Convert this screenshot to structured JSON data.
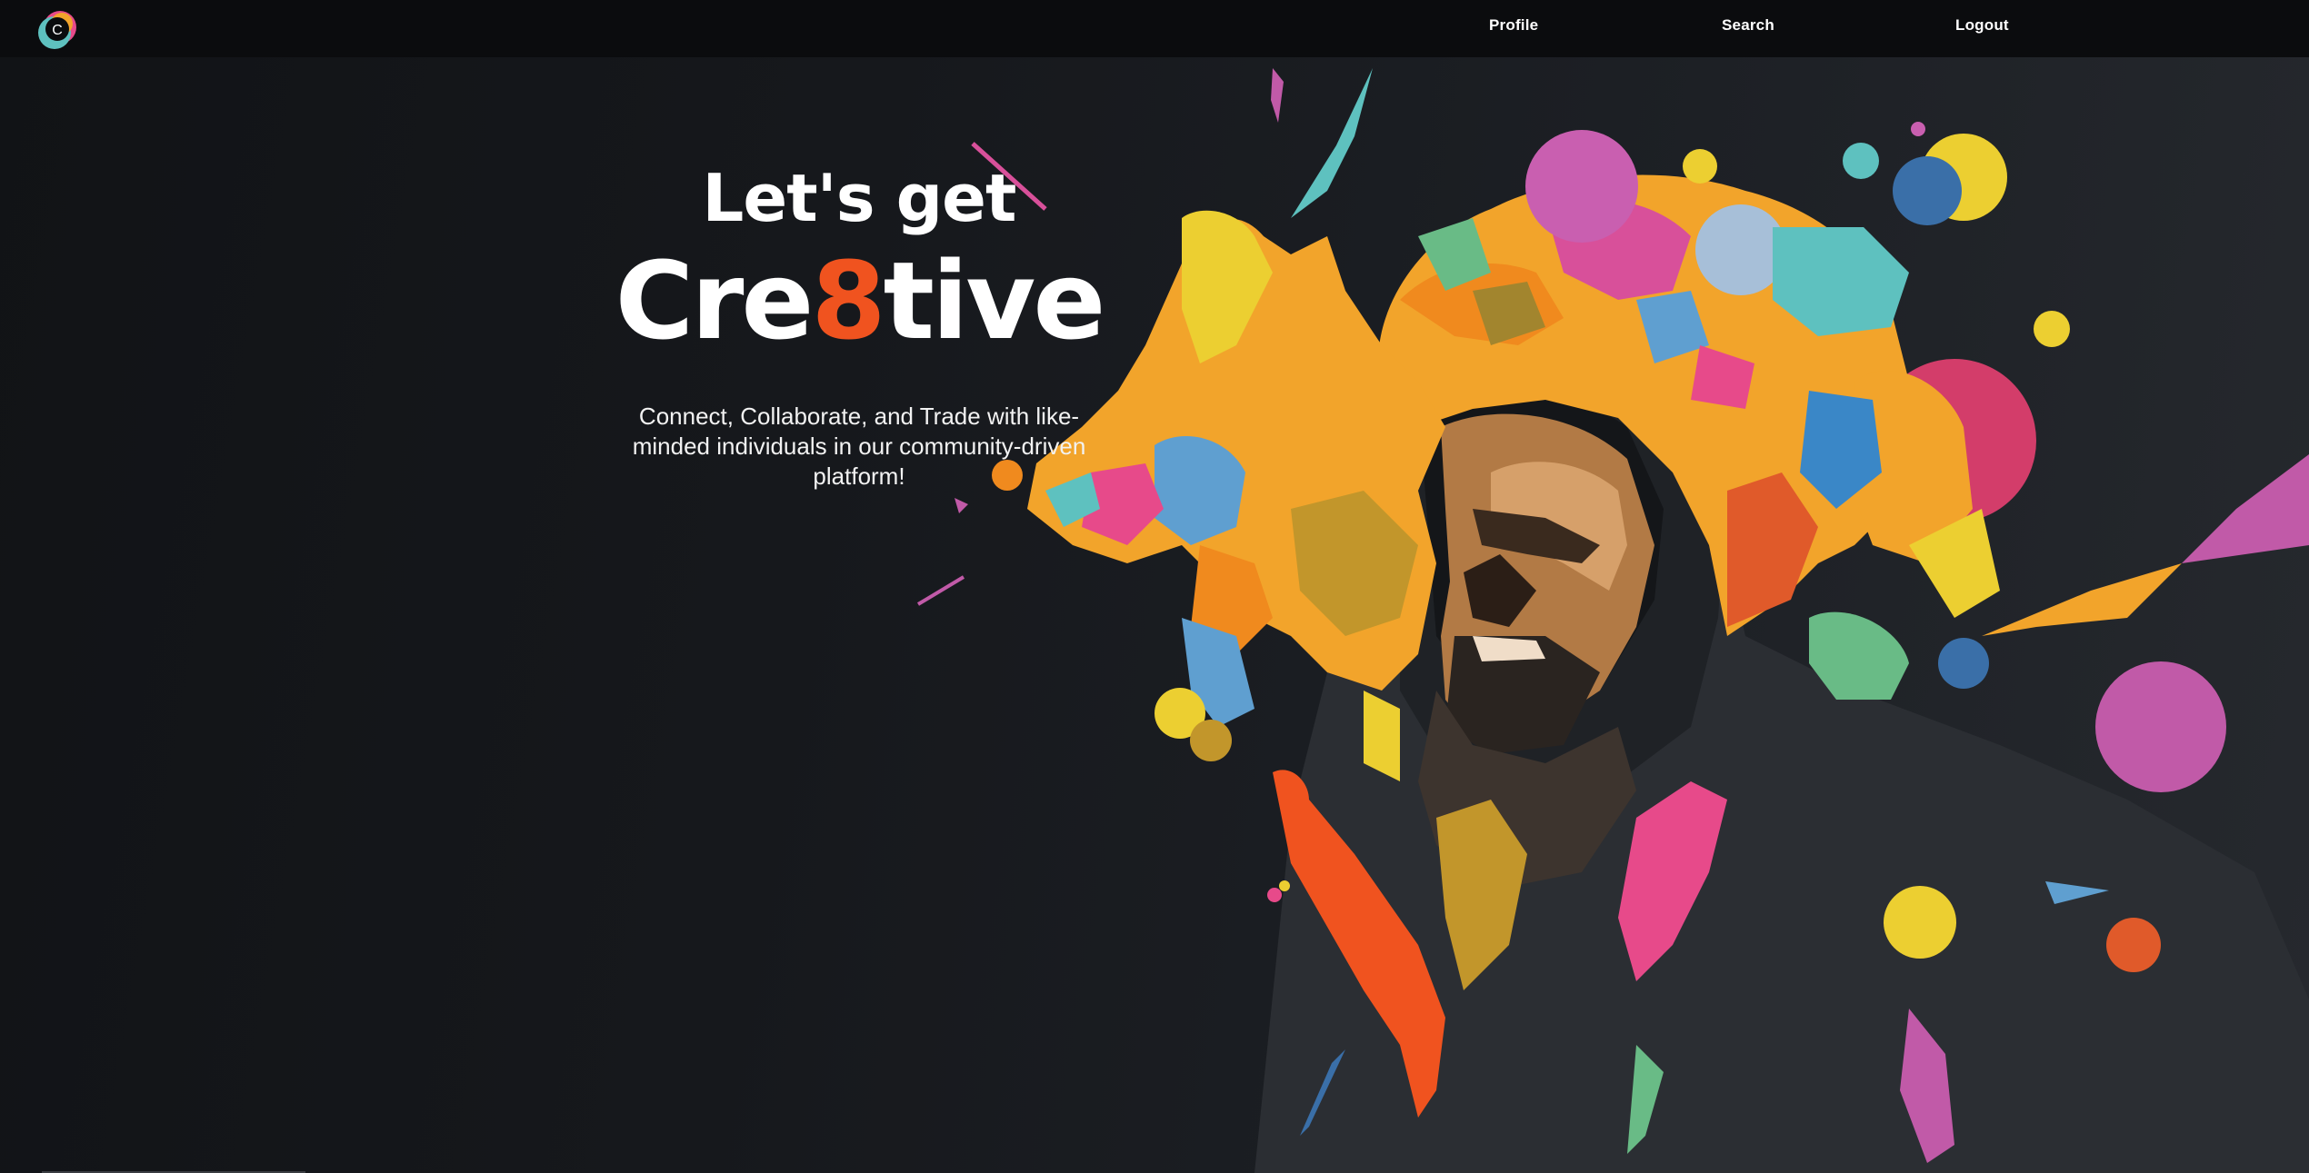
{
  "nav": {
    "logo_icon": "cre8tive-logo-icon",
    "links": [
      {
        "label": "Profile"
      },
      {
        "label": "Search"
      },
      {
        "label": "Logout"
      }
    ]
  },
  "hero": {
    "line1": "Let's get",
    "line2_prefix": "Cre",
    "line2_accent": "8",
    "line2_suffix": "tive",
    "tagline": "Connect, Collaborate, and Trade with like-minded individuals in our community-driven platform!"
  },
  "illustration": {
    "icon": "colorful-paint-splash-portrait-illustration"
  },
  "colors": {
    "background": "#17191d",
    "navbar": "#0b0c0e",
    "accent": "#f0531f",
    "text": "#ffffff"
  }
}
